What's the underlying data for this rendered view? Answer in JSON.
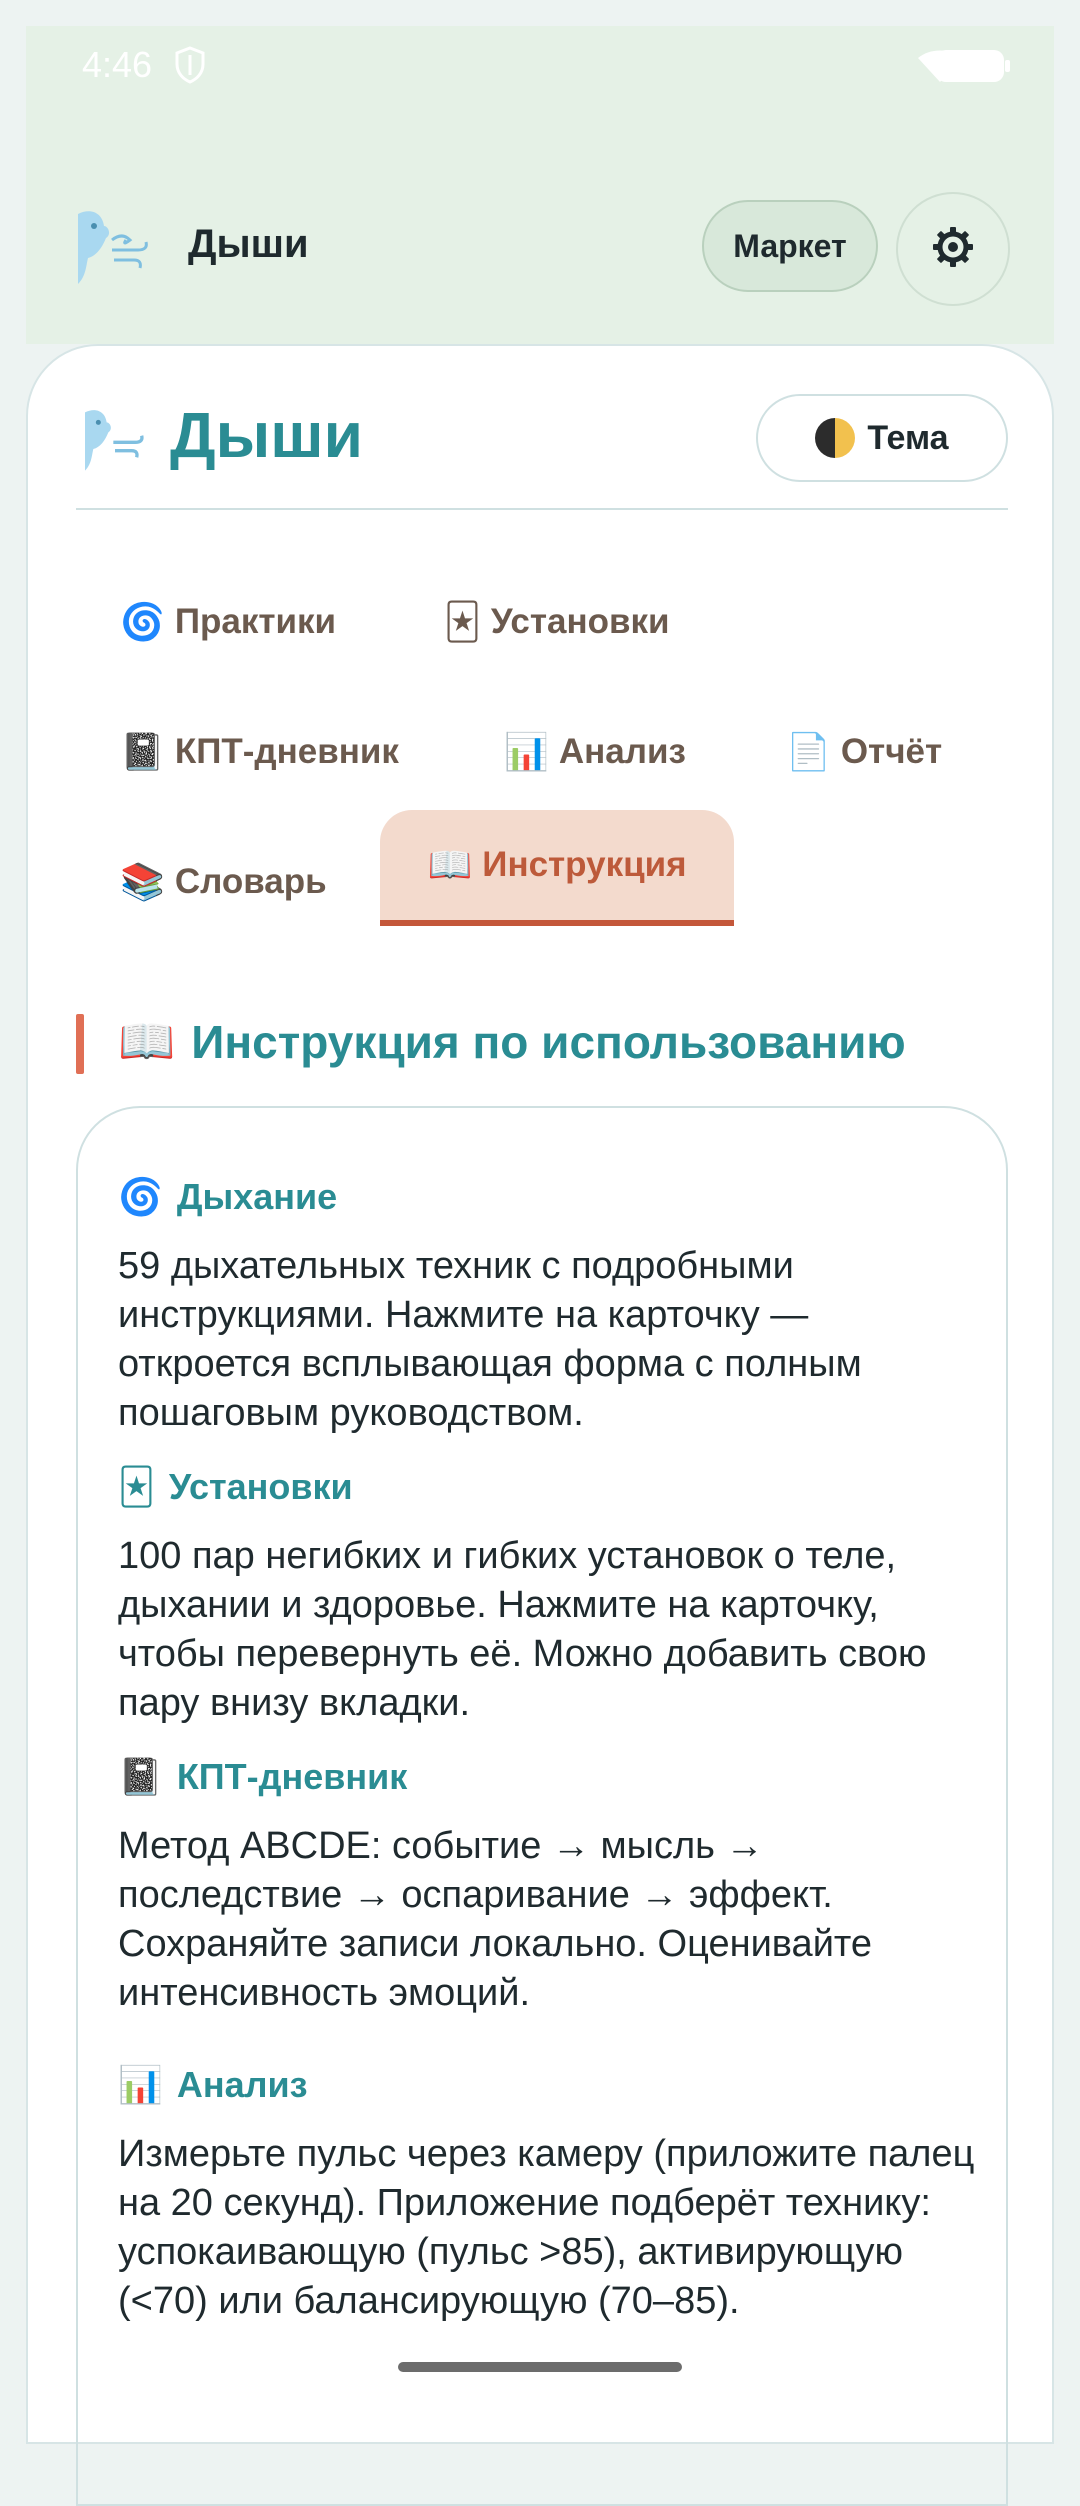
{
  "status_bar": {
    "time": "4:46"
  },
  "top_bar": {
    "title": "Дыши",
    "market_label": "Маркет"
  },
  "header": {
    "title": "Дыши",
    "theme_emoji": "🌓",
    "theme_label": "Тема"
  },
  "tabs": [
    {
      "emoji": "🌀",
      "label": "Практики",
      "active": false
    },
    {
      "emoji": "🃏",
      "label": "Установки",
      "active": false
    },
    {
      "emoji": "📓",
      "label": "КПТ-дневник",
      "active": false
    },
    {
      "emoji": "📊",
      "label": "Анализ",
      "active": false
    },
    {
      "emoji": "📄",
      "label": "Отчёт",
      "active": false
    },
    {
      "emoji": "📚",
      "label": "Словарь",
      "active": false
    },
    {
      "emoji": "📖",
      "label": "Инструкция",
      "active": true
    }
  ],
  "section": {
    "emoji": "📖",
    "title": "Инструкция по использованию"
  },
  "instructions": [
    {
      "emoji": "🌀",
      "heading": "Дыхание",
      "text": "59 дыхательных техник с подробными инструкциями. Нажмите на карточку — откроется всплывающая форма с полным пошаговым руководством."
    },
    {
      "emoji": "🃏",
      "heading": "Установки",
      "text": "100 пар негибких и гибких установок о теле, дыхании и здоровье. Нажмите на карточку, чтобы перевернуть её. Можно добавить свою пару внизу вкладки."
    },
    {
      "emoji": "📓",
      "heading": "КПТ-дневник",
      "text": "Метод ABCDE: событие → мысль → последствие → оспаривание → эффект. Сохраняйте записи локально. Оценивайте интенсивность эмоций."
    },
    {
      "emoji": "📊",
      "heading": "Анализ",
      "text": "Измерьте пульс через камеру (приложите палец на 20 секунд). Приложение подберёт технику: успокаивающую (пульс >85), активирующую (<70) или балансирующую (70–85)."
    }
  ],
  "colors": {
    "accent": "#2a8c93",
    "active_tab": "#bd5a3a",
    "app_bar_bg": "#e5f1e6"
  }
}
